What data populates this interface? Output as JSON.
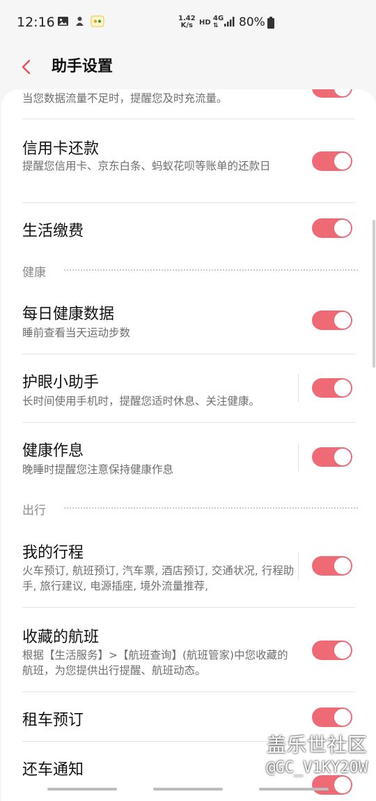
{
  "status_bar": {
    "time": "12:16",
    "net_speed_value": "1.42",
    "net_speed_unit": "K/s",
    "hd": "HD",
    "network": "4G",
    "battery": "80%"
  },
  "app_bar": {
    "title": "助手设置",
    "back_icon": "chevron-left-icon"
  },
  "rows": {
    "data_traffic": {
      "subtitle": "当您数据流量不足时，提醒您及时充流量。",
      "enabled": true
    },
    "credit_card": {
      "title": "信用卡还款",
      "subtitle": "提醒您信用卡、京东白条、蚂蚁花呗等账单的还款日",
      "enabled": true
    },
    "utilities": {
      "title": "生活缴费",
      "enabled": true
    },
    "daily_health": {
      "title": "每日健康数据",
      "subtitle": "睡前查看当天运动步数",
      "enabled": true
    },
    "eye_care": {
      "title": "护眼小助手",
      "subtitle": "长时间使用手机时，提醒您适时休息、关注健康。",
      "enabled": true
    },
    "health_routine": {
      "title": "健康作息",
      "subtitle": "晚睡时提醒您注意保持健康作息",
      "enabled": true
    },
    "my_trips": {
      "title": "我的行程",
      "subtitle": "火车预订, 航班预订, 汽车票, 酒店预订, 交通状况, 行程助手, 旅行建议, 电源插座, 境外流量推荐,",
      "enabled": true
    },
    "saved_flights": {
      "title": "收藏的航班",
      "subtitle": "根据【生活服务】>【航班查询】(航班管家)中您收藏的航班，为您提供出行提醒、航班动态。",
      "enabled": true
    },
    "car_rental": {
      "title": "租车预订",
      "enabled": true
    },
    "car_return": {
      "title": "还车通知",
      "enabled": true
    }
  },
  "sections": {
    "health": "健康",
    "travel": "出行"
  },
  "watermark": {
    "line1": "盖乐世社区",
    "line2": "@GC_V1KY20W"
  },
  "colors": {
    "accent": "#ee6b76",
    "background": "#f6f6f6",
    "card": "#ffffff"
  }
}
